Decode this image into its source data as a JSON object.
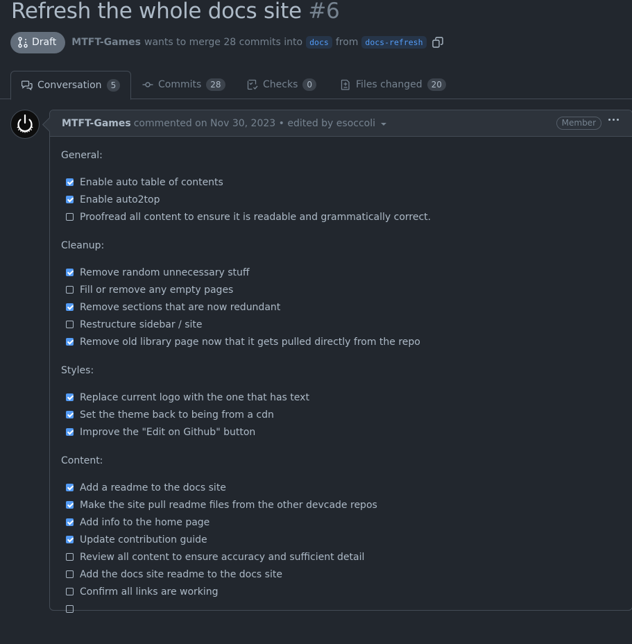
{
  "pr": {
    "title": "Refresh the whole docs site",
    "number": "#6",
    "state": "Draft",
    "author": "MTFT-Games",
    "merge_text": "wants to merge 28 commits into",
    "base_branch": "docs",
    "from_text": "from",
    "head_branch": "docs-refresh"
  },
  "tabs": [
    {
      "label": "Conversation",
      "count": "5",
      "icon": "comment-discussion-icon",
      "selected": true
    },
    {
      "label": "Commits",
      "count": "28",
      "icon": "git-commit-icon"
    },
    {
      "label": "Checks",
      "count": "0",
      "icon": "checklist-icon"
    },
    {
      "label": "Files changed",
      "count": "20",
      "icon": "file-diff-icon"
    }
  ],
  "comment": {
    "author": "MTFT-Games",
    "action": "commented on Nov 30, 2023 • edited by esoccoli",
    "role": "Member",
    "sections": [
      {
        "title": "General:",
        "items": [
          {
            "text": "Enable auto table of contents",
            "checked": true
          },
          {
            "text": "Enable auto2top",
            "checked": true
          },
          {
            "text": "Proofread all content to ensure it is readable and grammatically correct.",
            "checked": false
          }
        ]
      },
      {
        "title": "Cleanup:",
        "items": [
          {
            "text": "Remove random unnecessary stuff",
            "checked": true
          },
          {
            "text": "Fill or remove any empty pages",
            "checked": false
          },
          {
            "text": "Remove sections that are now redundant",
            "checked": true
          },
          {
            "text": "Restructure sidebar / site",
            "checked": false
          },
          {
            "text": "Remove old library page now that it gets pulled directly from the repo",
            "checked": true
          }
        ]
      },
      {
        "title": "Styles:",
        "items": [
          {
            "text": "Replace current logo with the one that has text",
            "checked": true
          },
          {
            "text": "Set the theme back to being from a cdn",
            "checked": true
          },
          {
            "text": "Improve the \"Edit on Github\" button",
            "checked": true
          }
        ]
      },
      {
        "title": "Content:",
        "items": [
          {
            "text": "Add a readme to the docs site",
            "checked": true
          },
          {
            "text": "Make the site pull readme files from the other devcade repos",
            "checked": true
          },
          {
            "text": "Add info to the home page",
            "checked": true
          },
          {
            "text": "Update contribution guide",
            "checked": true
          },
          {
            "text": "Review all content to ensure accuracy and sufficient detail",
            "checked": false
          },
          {
            "text": "Add the docs site readme to the docs site",
            "checked": false
          },
          {
            "text": "Confirm all links are working",
            "checked": false
          },
          {
            "text": "",
            "checked": false
          }
        ]
      }
    ]
  },
  "colors": {
    "background": "#22272e",
    "header_bg": "#2d333b",
    "accent": "#539bf5",
    "draft_badge": "#636e7b"
  }
}
